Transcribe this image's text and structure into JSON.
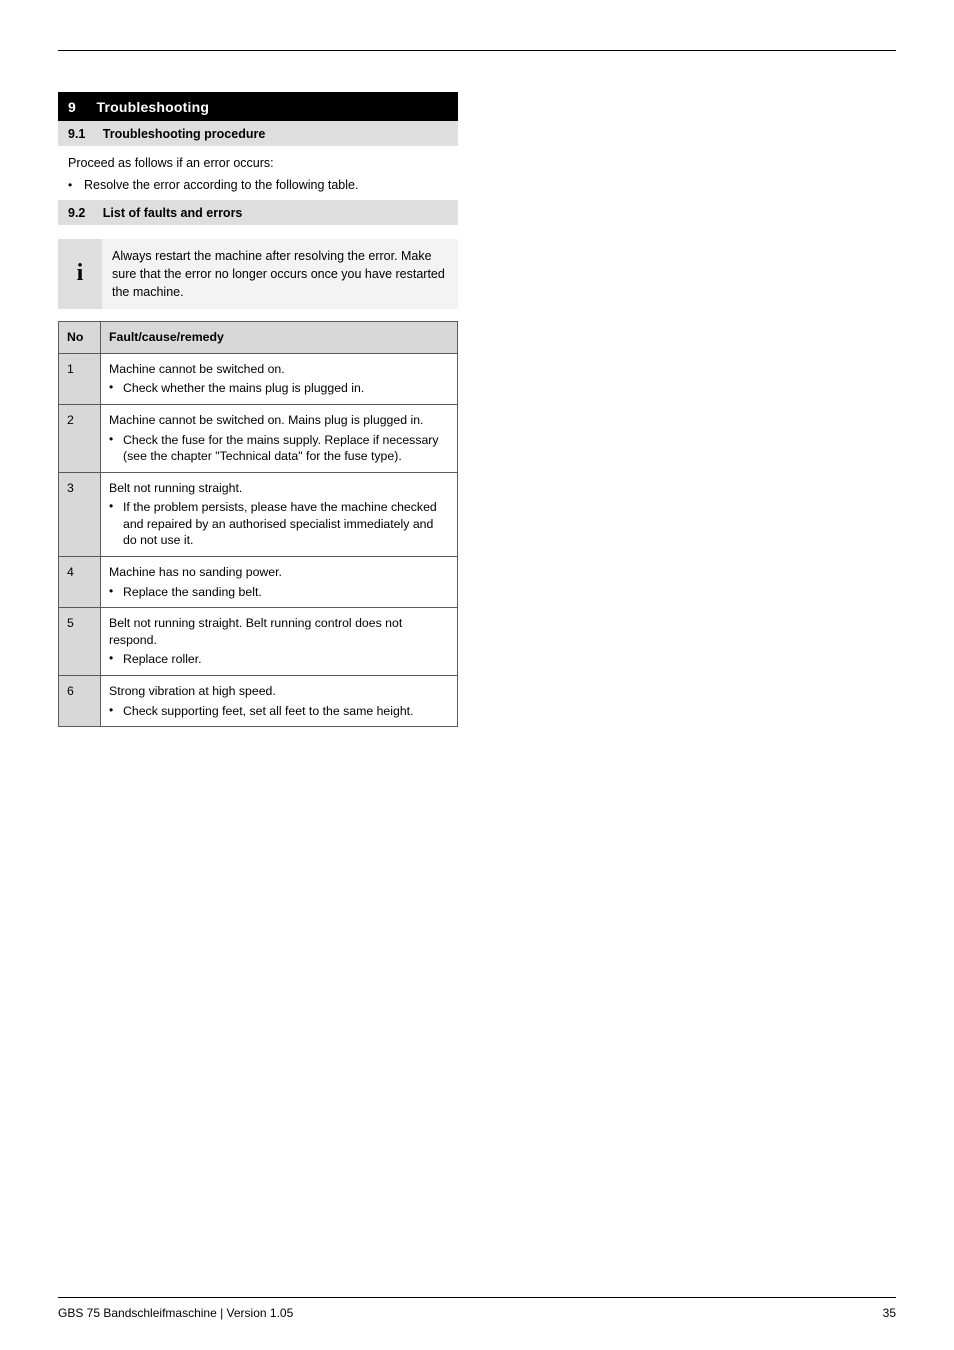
{
  "section_number": "9",
  "section_title": "Troubleshooting",
  "subsection_number": "9.1",
  "subsection_title": "Troubleshooting procedure",
  "intro_text": "Proceed as follows if an error occurs:",
  "intro_bullet": "Resolve the error according to the following table.",
  "table_heading_number": "9.2",
  "table_heading_title": "List of faults and errors",
  "note_text": "Always restart the machine after resolving the error. Make sure that the error no longer occurs once you have restarted the machine.",
  "table": {
    "head_no": "No",
    "head_cause": "Fault/cause/remedy",
    "rows": [
      {
        "code": "1",
        "fault": "Machine cannot be switched on.",
        "bullets": [
          "Check whether the mains plug is plugged in."
        ]
      },
      {
        "code": "2",
        "fault": "Machine cannot be switched on. Mains plug is plugged in.",
        "bullets": [
          "Check the fuse for the mains supply. Replace if necessary (see the chapter \"Technical data\" for the fuse type)."
        ]
      },
      {
        "code": "3",
        "fault": "Belt not running straight.",
        "bullets": [
          "If the problem persists, please have the machine checked and repaired by an authorised specialist immediately and do not use it."
        ]
      },
      {
        "code": "4",
        "fault": "Machine has no sanding power.",
        "bullets": [
          "Replace the sanding belt."
        ]
      },
      {
        "code": "5",
        "fault": "Belt not running straight. Belt running control does not respond.",
        "bullets": [
          "Replace roller."
        ]
      },
      {
        "code": "6",
        "fault": "Strong vibration at high speed.",
        "bullets": [
          "Check supporting feet, set all feet to the same height."
        ]
      }
    ]
  },
  "footer_left": "GBS 75 Bandschleifmaschine | Version 1.05",
  "footer_right": "35"
}
